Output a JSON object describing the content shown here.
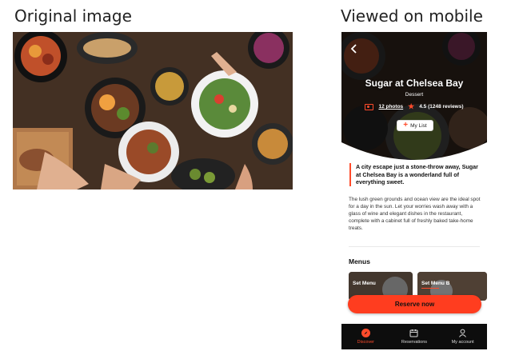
{
  "captions": {
    "original": "Original image",
    "mobile": "Viewed on mobile"
  },
  "restaurant": {
    "name": "Sugar at Chelsea Bay",
    "category": "Dessert",
    "photos_label": "12 photos",
    "rating_label": "4.5 (1248 reviews)",
    "my_list_label": "My List"
  },
  "content": {
    "intro": "A city escape just a stone-throw away, Sugar at Chelsea Bay is a wonderland full of everything sweet.",
    "body": "The lush green grounds and ocean view are the ideal spot for a day in the sun. Let your worries wash away with a glass of wine and elegant dishes in the restaurant, complete with a cabinet full of freshly baked take-home treats."
  },
  "menus": {
    "heading": "Menus",
    "items": [
      {
        "label": "Set Menu"
      },
      {
        "label": "Set Menu B"
      }
    ]
  },
  "reserve_label": "Reserve now",
  "tabs": [
    {
      "label": "Discover",
      "icon": "compass-icon",
      "active": true
    },
    {
      "label": "Reservations",
      "icon": "calendar-icon",
      "active": false
    },
    {
      "label": "My account",
      "icon": "user-icon",
      "active": false
    }
  ],
  "colors": {
    "accent": "#ff4b2b",
    "tabbar": "#0d0d0d"
  }
}
